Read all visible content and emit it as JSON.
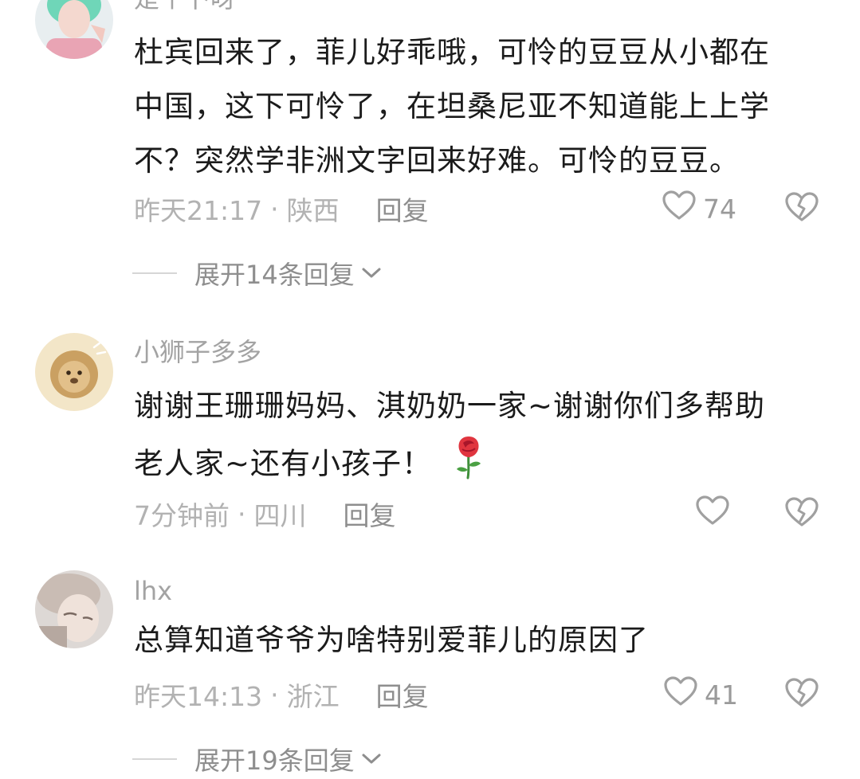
{
  "comments": [
    {
      "username": "是个卜呀",
      "lines": [
        "杜宾回来了，菲儿好乖哦，可怜的豆豆从小都在",
        "中国，这下可怜了，在坦桑尼亚不知道能上上学",
        "不？突然学非洲文字回来好难。可怜的豆豆。"
      ],
      "time": "昨天21:17",
      "separator": "·",
      "location": "陕西",
      "reply_label": "回复",
      "likes": "74",
      "expand_label": "展开14条回复"
    },
    {
      "username": "小狮子多多",
      "lines": [
        "谢谢王珊珊妈妈、淇奶奶一家~谢谢你们多帮助",
        "老人家~还有小孩子！"
      ],
      "time": "7分钟前",
      "separator": "·",
      "location": "四川",
      "reply_label": "回复",
      "likes": ""
    },
    {
      "username": "lhx",
      "lines": [
        "总算知道爷爷为啥特别爱菲儿的原因了"
      ],
      "time": "昨天14:13",
      "separator": "·",
      "location": "浙江",
      "reply_label": "回复",
      "likes": "41",
      "expand_label": "展开19条回复"
    }
  ],
  "icons": {
    "like": "heart-outline-icon",
    "dislike": "broken-heart-icon",
    "expand": "chevron-down-icon",
    "emoji": "rose-emoji"
  },
  "colors": {
    "text": "#1b1b1b",
    "muted": "#b2b2b2",
    "reply": "#8e8e8e",
    "icon": "#a0a0a0"
  }
}
